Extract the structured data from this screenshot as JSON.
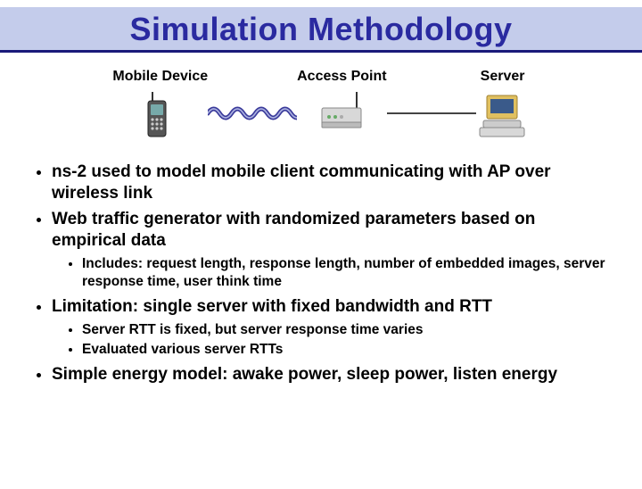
{
  "title": "Simulation Methodology",
  "diagram": {
    "mobile_label": "Mobile Device",
    "ap_label": "Access Point",
    "server_label": "Server"
  },
  "bullets": {
    "b1": "ns-2 used to model mobile client communicating with AP over wireless link",
    "b2": "Web traffic generator with randomized parameters based on empirical data",
    "b2_sub1": "Includes: request length, response length, number of embedded images, server response time, user think time",
    "b3": "Limitation: single server with fixed bandwidth and RTT",
    "b3_sub1": "Server RTT is fixed, but server response time varies",
    "b3_sub2": "Evaluated various server RTTs",
    "b4": "Simple energy model: awake power, sleep power, listen energy"
  }
}
